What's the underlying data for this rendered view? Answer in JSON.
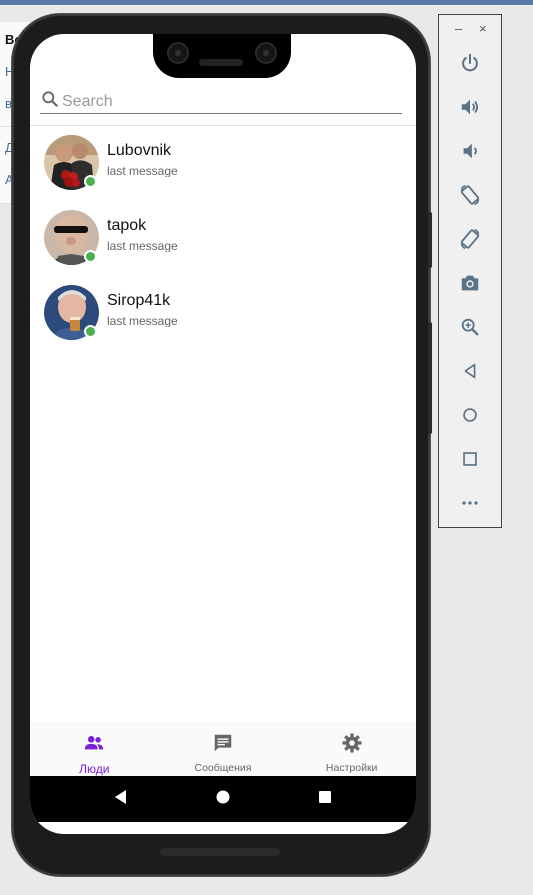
{
  "background_page": {
    "lines": [
      "Во",
      "Н",
      "в",
      "Д",
      "А"
    ]
  },
  "search": {
    "placeholder": "Search",
    "value": ""
  },
  "contacts": [
    {
      "name": "Lubovnik",
      "last_message": "last message",
      "online": true
    },
    {
      "name": "tapok",
      "last_message": "last message",
      "online": true
    },
    {
      "name": "Sirop41k",
      "last_message": "last message",
      "online": true
    }
  ],
  "bottom_nav": {
    "items": [
      {
        "label": "Люди",
        "icon": "people-icon",
        "active": true
      },
      {
        "label": "Сообщения",
        "icon": "message-icon",
        "active": false
      },
      {
        "label": "Настройки",
        "icon": "gear-icon",
        "active": false
      }
    ]
  },
  "emulator_toolbar": {
    "minimize": "–",
    "close": "×",
    "tools": [
      "power-icon",
      "volume-up-icon",
      "volume-down-icon",
      "rotate-left-icon",
      "rotate-right-icon",
      "camera-icon",
      "zoom-icon",
      "back-icon",
      "home-icon",
      "overview-icon",
      "more-icon"
    ]
  },
  "colors": {
    "accent": "#7a1fd6",
    "online": "#4caf50",
    "topbar": "#5a79a8"
  }
}
